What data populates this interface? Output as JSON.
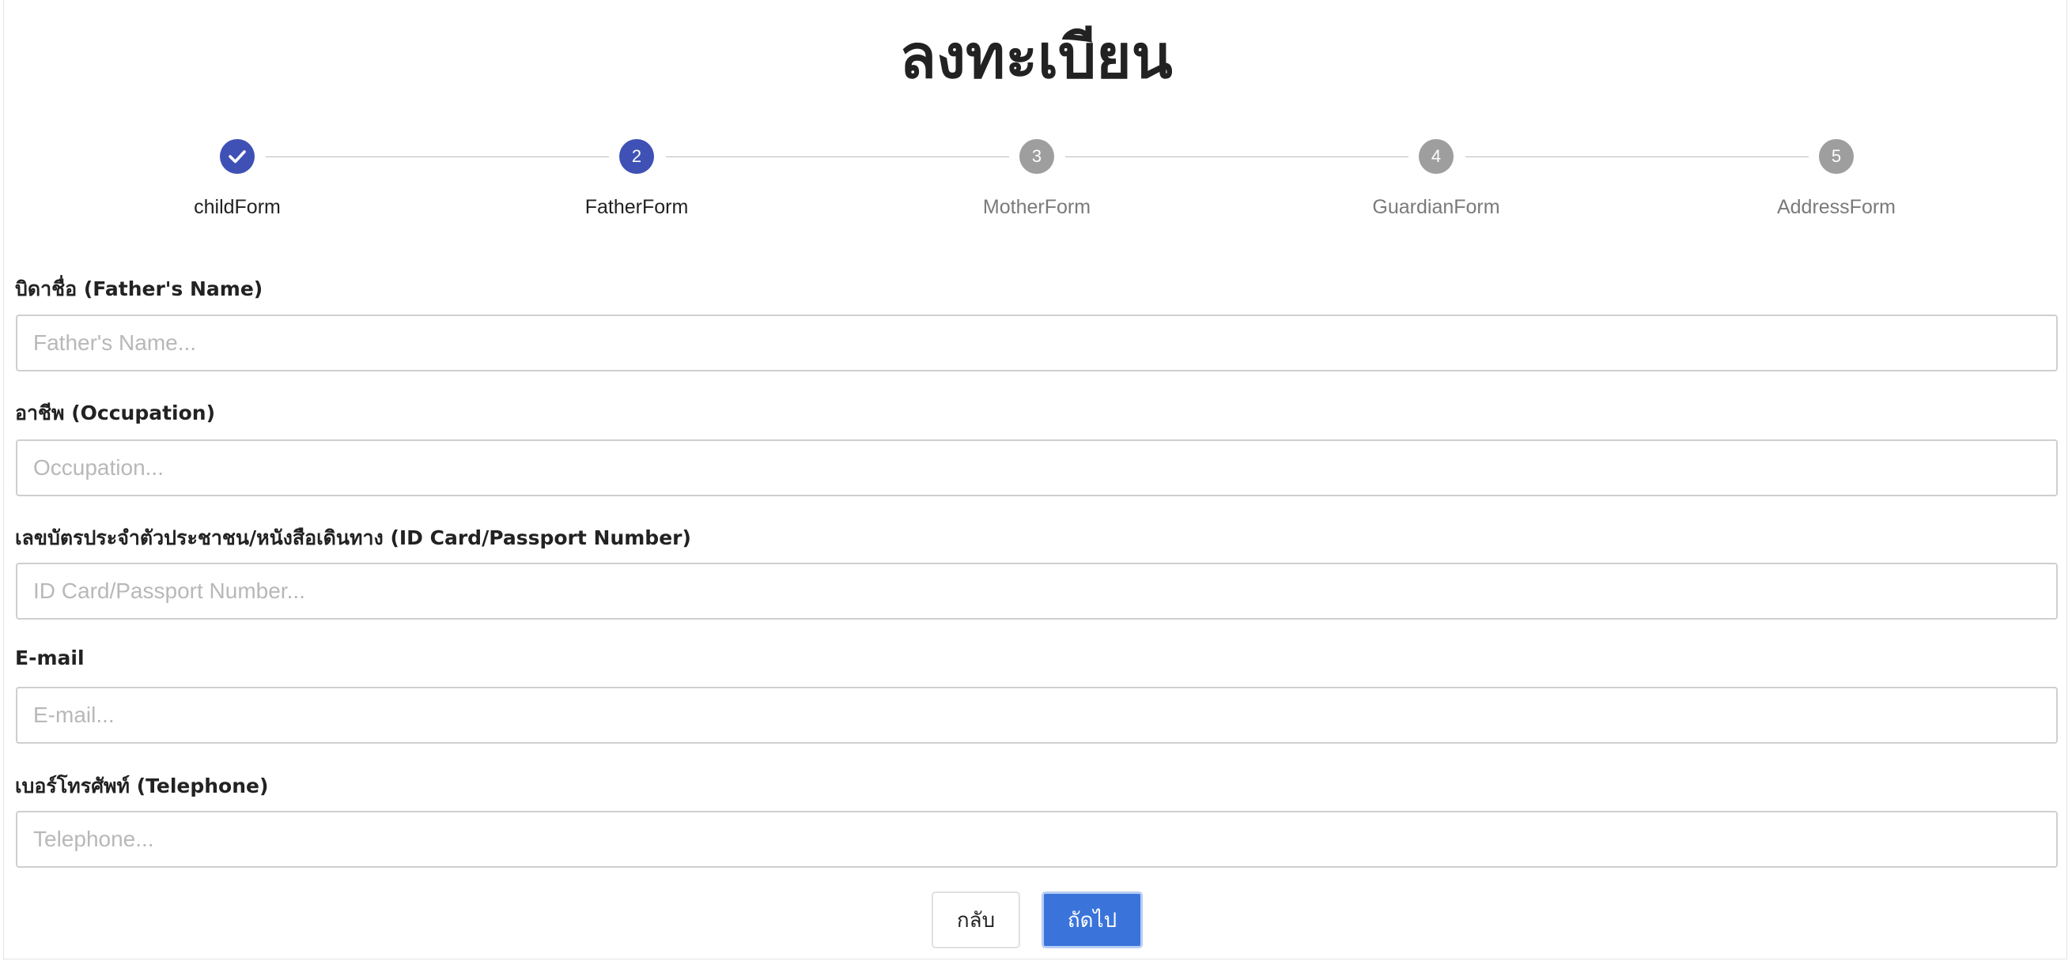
{
  "page": {
    "title": "ลงทะเบียน"
  },
  "stepper": {
    "steps": [
      {
        "label": "childForm",
        "number": "1",
        "state": "done"
      },
      {
        "label": "FatherForm",
        "number": "2",
        "state": "active"
      },
      {
        "label": "MotherForm",
        "number": "3",
        "state": "pending"
      },
      {
        "label": "GuardianForm",
        "number": "4",
        "state": "pending"
      },
      {
        "label": "AddressForm",
        "number": "5",
        "state": "pending"
      }
    ],
    "active_color": "#3f51b5",
    "pending_color": "#9e9e9e",
    "done_icon": "check-icon"
  },
  "form": {
    "father_name": {
      "label": "บิดาชื่อ (Father's Name)",
      "placeholder": "Father's Name...",
      "value": ""
    },
    "occupation": {
      "label": "อาชีพ (Occupation)",
      "placeholder": "Occupation...",
      "value": ""
    },
    "id_card": {
      "label": "เลขบัตรประจำตัวประชาชน/หนังสือเดินทาง (ID Card/Passport Number)",
      "placeholder": "ID Card/Passport Number...",
      "value": ""
    },
    "email": {
      "label": "E-mail",
      "placeholder": "E-mail...",
      "value": ""
    },
    "telephone": {
      "label": "เบอร์โทรศัพท์ (Telephone)",
      "placeholder": "Telephone...",
      "value": ""
    }
  },
  "actions": {
    "back_label": "กลับ",
    "next_label": "ถัดไป",
    "next_color": "#3a74db"
  }
}
